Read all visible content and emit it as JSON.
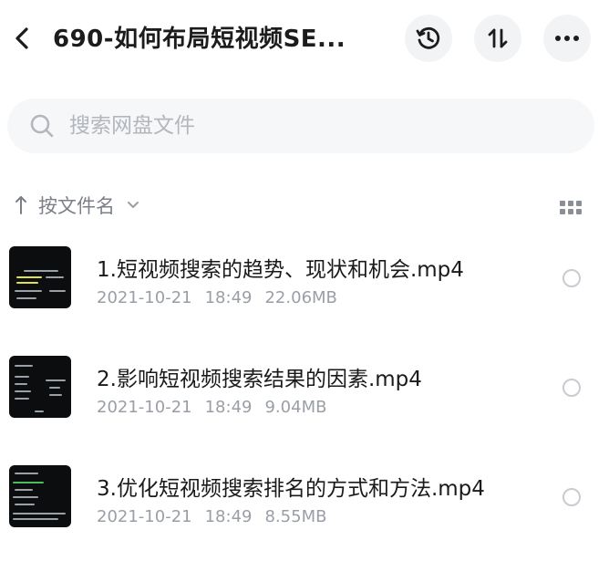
{
  "header": {
    "title": "690-如何布局短视频SE...",
    "back_icon": "chevron-left-icon",
    "history_icon": "history-clock-icon",
    "sort_icon": "sort-updown-icon",
    "more_icon": "more-dots-icon"
  },
  "search": {
    "placeholder": "搜索网盘文件",
    "value": ""
  },
  "sort": {
    "label": "按文件名",
    "direction_icon": "arrow-up-icon",
    "caret_icon": "chevron-down-icon",
    "view_icon": "grid-view-icon"
  },
  "files": [
    {
      "name": "1.短视频搜索的趋势、现状和机会.mp4",
      "date": "2021-10-21",
      "time": "18:49",
      "size": "22.06MB"
    },
    {
      "name": "2.影响短视频搜索结果的因素.mp4",
      "date": "2021-10-21",
      "time": "18:49",
      "size": "9.04MB"
    },
    {
      "name": "3.优化短视频搜索排名的方式和方法.mp4",
      "date": "2021-10-21",
      "time": "18:49",
      "size": "8.55MB"
    }
  ],
  "colors": {
    "accent_text": "#1a1a1a",
    "muted_text": "#9a9ea6",
    "button_bg": "#f2f3f5",
    "search_bg": "#f6f7f9"
  }
}
